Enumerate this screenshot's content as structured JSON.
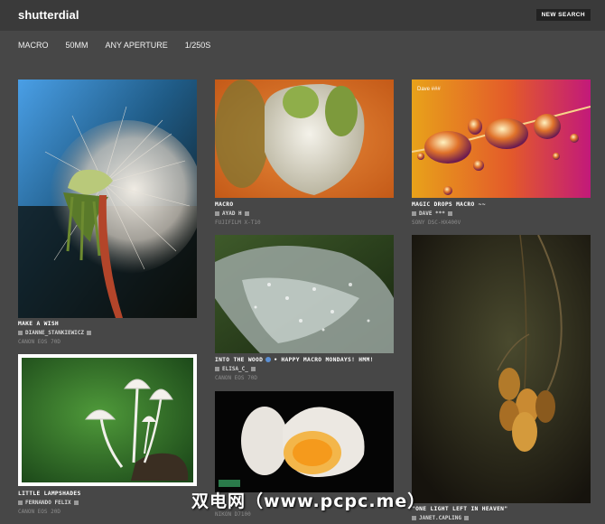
{
  "app": {
    "logo": "shutterdial",
    "new_search": "NEW SEARCH"
  },
  "filters": [
    "MACRO",
    "50MM",
    "ANY APERTURE",
    "1/250S"
  ],
  "photos": [
    {
      "title": "MAKE A WISH",
      "author": "DIANNE_STANKIEWICZ",
      "camera": "CANON EOS 70D"
    },
    {
      "title": "LITTLE LAMPSHADES",
      "author": "FERNANDO FELIX",
      "camera": "CANON EOS 20D"
    },
    {
      "title": "MACRO",
      "author": "AYAD H",
      "camera": "FUJIFILM X-T10"
    },
    {
      "title": "INTO THE WOOD",
      "title_suffix": "HAPPY MACRO MONDAYS! HMM!",
      "author": "ELISA_C_",
      "camera": "CANON EOS 70D"
    },
    {
      "title": "",
      "author": "",
      "camera": "NIKON D7100"
    },
    {
      "title": "MAGIC DROPS MACRO ~~",
      "author": "DAVE ***",
      "camera": "SONY DSC-HX400V"
    },
    {
      "title": "\"ONE LIGHT LEFT IN HEAVEN\"",
      "author": "JANET.CAPLING",
      "camera": ""
    }
  ],
  "watermark": "双电网（www.pcpc.me）",
  "photo_overlays": {
    "drops_logo": "Dave ###"
  }
}
